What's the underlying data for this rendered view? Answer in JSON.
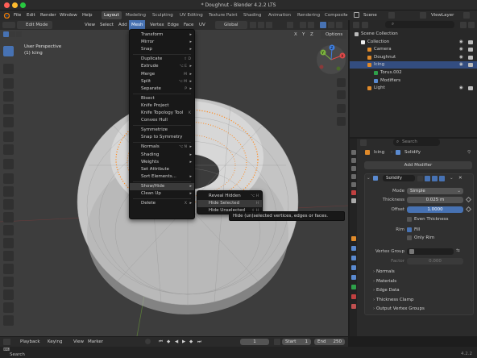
{
  "window": {
    "title": "* Doughnut - Blender 4.2.2 LTS"
  },
  "top_menu": [
    "File",
    "Edit",
    "Render",
    "Window",
    "Help"
  ],
  "workspaces": [
    {
      "label": "Layout",
      "active": true
    },
    {
      "label": "Modeling",
      "active": false
    },
    {
      "label": "Sculpting",
      "active": false
    },
    {
      "label": "UV Editing",
      "active": false
    },
    {
      "label": "Texture Paint",
      "active": false
    },
    {
      "label": "Shading",
      "active": false
    },
    {
      "label": "Animation",
      "active": false
    },
    {
      "label": "Rendering",
      "active": false
    },
    {
      "label": "Composit",
      "active": false
    }
  ],
  "scene": {
    "scene_name": "Scene",
    "view_layer": "ViewLayer"
  },
  "viewport_header": {
    "mode": "Edit Mode",
    "menus": [
      "View",
      "Select",
      "Add",
      "Mesh",
      "Vertex",
      "Edge",
      "Face",
      "UV"
    ],
    "transform_orientation": "Global",
    "options_label": "Options",
    "axes": [
      "X",
      "Y",
      "Z"
    ]
  },
  "viewport_info": {
    "line1": "User Perspective",
    "line2": "(1) Icing"
  },
  "gizmo": {
    "x": "X",
    "y": "Y",
    "z": "Z"
  },
  "mesh_menu": {
    "items": [
      {
        "label": "Transform",
        "shortcut": "",
        "submenu": true
      },
      {
        "label": "Mirror",
        "shortcut": "",
        "submenu": true
      },
      {
        "label": "Snap",
        "shortcut": "",
        "submenu": true
      },
      {
        "label": "Duplicate",
        "shortcut": "⇧ D",
        "submenu": false
      },
      {
        "label": "Extrude",
        "shortcut": "⌥ E",
        "submenu": true
      },
      {
        "label": "Merge",
        "shortcut": "M",
        "submenu": true
      },
      {
        "label": "Split",
        "shortcut": "⌥ M",
        "submenu": true
      },
      {
        "label": "Separate",
        "shortcut": "P",
        "submenu": true
      },
      {
        "label": "Bisect",
        "shortcut": "",
        "submenu": false
      },
      {
        "label": "Knife Project",
        "shortcut": "",
        "submenu": false
      },
      {
        "label": "Knife Topology Tool",
        "shortcut": "K",
        "submenu": false
      },
      {
        "label": "Convex Hull",
        "shortcut": "",
        "submenu": false
      },
      {
        "label": "Symmetrize",
        "shortcut": "",
        "submenu": false
      },
      {
        "label": "Snap to Symmetry",
        "shortcut": "",
        "submenu": false
      },
      {
        "label": "Normals",
        "shortcut": "⌥ N",
        "submenu": true
      },
      {
        "label": "Shading",
        "shortcut": "",
        "submenu": true
      },
      {
        "label": "Weights",
        "shortcut": "",
        "submenu": true
      },
      {
        "label": "Set Attribute",
        "shortcut": "",
        "submenu": false
      },
      {
        "label": "Sort Elements...",
        "shortcut": "",
        "submenu": true
      },
      {
        "label": "Show/Hide",
        "shortcut": "",
        "submenu": true
      },
      {
        "label": "Clean Up",
        "shortcut": "",
        "submenu": true
      },
      {
        "label": "Delete",
        "shortcut": "X",
        "submenu": true
      }
    ]
  },
  "showhide_menu": {
    "items": [
      {
        "label": "Reveal Hidden",
        "shortcut": "⌥ H"
      },
      {
        "label": "Hide Selected",
        "shortcut": "H"
      },
      {
        "label": "Hide Unselected",
        "shortcut": "⇧ H"
      }
    ]
  },
  "tooltip": "Hide (un)selected vertices, edges or faces.",
  "outliner": {
    "search_placeholder": "",
    "rows": [
      {
        "label": "Scene Collection",
        "indent": 0,
        "selected": false
      },
      {
        "label": "Collection",
        "indent": 1,
        "selected": false
      },
      {
        "label": "Camera",
        "indent": 2,
        "selected": false
      },
      {
        "label": "Doughnut",
        "indent": 2,
        "selected": false
      },
      {
        "label": "Icing",
        "indent": 2,
        "selected": true
      },
      {
        "label": "Torus.002",
        "indent": 3,
        "selected": false
      },
      {
        "label": "Modifiers",
        "indent": 3,
        "selected": false
      },
      {
        "label": "Light",
        "indent": 2,
        "selected": false
      }
    ]
  },
  "properties": {
    "search_placeholder": "Search",
    "breadcrumb_object": "Icing",
    "breadcrumb_modifier": "Solidify",
    "add_modifier_label": "Add Modifier",
    "modifier_name": "Solidify",
    "mode_label": "Mode",
    "mode_value": "Simple",
    "thickness_label": "Thickness",
    "thickness_value": "0.025 m",
    "offset_label": "Offset",
    "offset_value": "1.0000",
    "even_thickness_label": "Even Thickness",
    "rim_label": "Rim",
    "fill_label": "Fill",
    "only_rim_label": "Only Rim",
    "vertex_group_label": "Vertex Group",
    "factor_label": "Factor",
    "factor_value": "0.000",
    "panels": [
      "Normals",
      "Materials",
      "Edge Data",
      "Thickness Clamp",
      "Output Vertex Groups"
    ]
  },
  "timeline": {
    "playback": "Playback",
    "keying": "Keying",
    "view": "View",
    "marker": "Marker",
    "current_frame": "1",
    "start_label": "Start",
    "start_value": "1",
    "end_label": "End",
    "end_value": "250"
  },
  "status_bar": {
    "left": "Search",
    "version": "4.2.2"
  },
  "colors": {
    "accent": "#4772b3",
    "menu_bg": "#181818",
    "viewport_bg": "#3d3d3d",
    "selection": "#ff8a1f"
  }
}
